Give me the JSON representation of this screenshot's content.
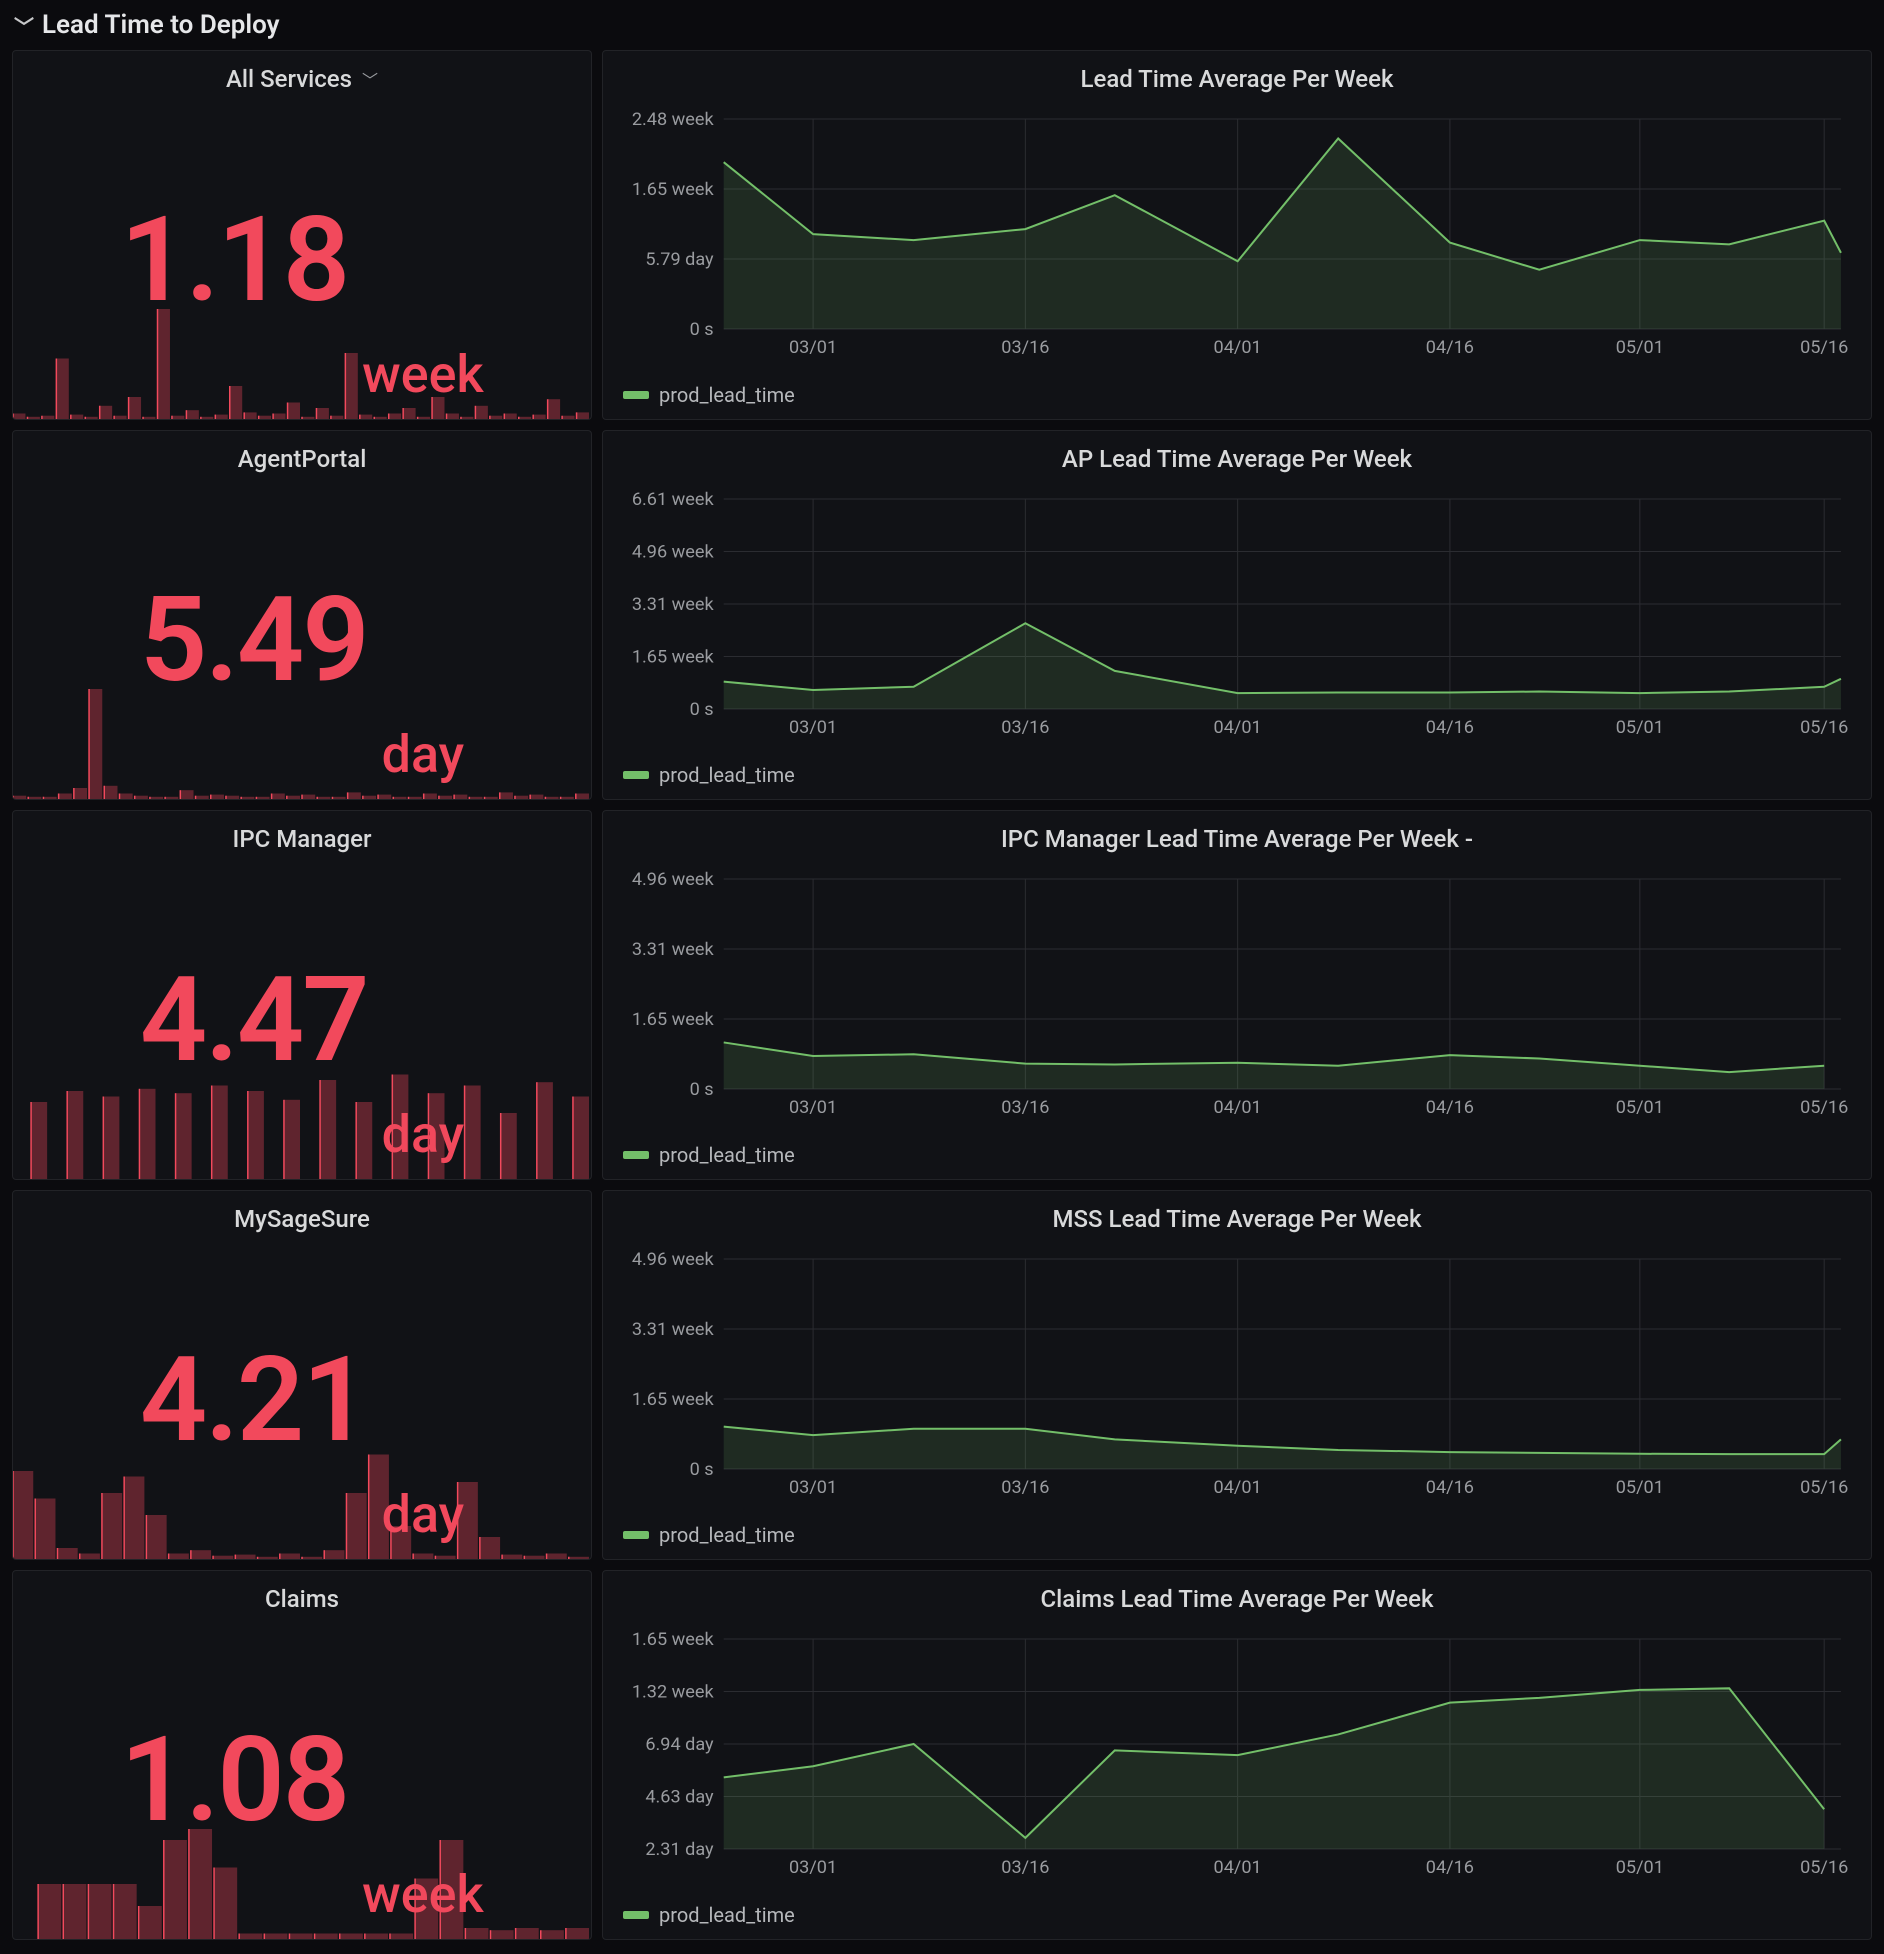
{
  "section_title": "Lead Time to Deploy",
  "rows": [
    {
      "stat": {
        "title": "All Services",
        "has_dropdown": true,
        "value": "1.18",
        "unit": "week"
      },
      "chart_title": "Lead Time Average Per Week",
      "legend": "prod_lead_time"
    },
    {
      "stat": {
        "title": "AgentPortal",
        "has_dropdown": false,
        "value": "5.49",
        "unit": "day"
      },
      "chart_title": "AP Lead Time Average Per Week",
      "legend": "prod_lead_time"
    },
    {
      "stat": {
        "title": "IPC Manager",
        "has_dropdown": false,
        "value": "4.47",
        "unit": "day"
      },
      "chart_title": "IPC Manager Lead Time Average Per Week -",
      "legend": "prod_lead_time"
    },
    {
      "stat": {
        "title": "MySageSure",
        "has_dropdown": false,
        "value": "4.21",
        "unit": "day"
      },
      "chart_title": "MSS Lead Time Average Per Week",
      "legend": "prod_lead_time"
    },
    {
      "stat": {
        "title": "Claims",
        "has_dropdown": false,
        "value": "1.08",
        "unit": "week"
      },
      "chart_title": "Claims Lead Time Average Per Week",
      "legend": "prod_lead_time"
    }
  ],
  "chart_data": [
    {
      "type": "line",
      "title": "Lead Time Average Per Week",
      "xlabel": "",
      "ylabel": "",
      "x_ticks": [
        "03/01",
        "03/16",
        "04/01",
        "04/16",
        "05/01",
        "05/16"
      ],
      "y_ticks": [
        "0 s",
        "5.79 day",
        "1.65 week",
        "2.48 week"
      ],
      "ylim_weeks": [
        0,
        2.48
      ],
      "series": [
        {
          "name": "prod_lead_time",
          "x": [
            "02/22",
            "03/01",
            "03/08",
            "03/16",
            "03/23",
            "04/01",
            "04/08",
            "04/16",
            "04/23",
            "05/01",
            "05/08",
            "05/16",
            "05/20"
          ],
          "y_weeks": [
            1.97,
            1.12,
            1.05,
            1.18,
            1.58,
            0.8,
            2.25,
            1.02,
            0.7,
            1.05,
            1.0,
            1.28,
            0.9
          ]
        }
      ]
    },
    {
      "type": "line",
      "title": "AP Lead Time Average Per Week",
      "xlabel": "",
      "ylabel": "",
      "x_ticks": [
        "03/01",
        "03/16",
        "04/01",
        "04/16",
        "05/01",
        "05/16"
      ],
      "y_ticks": [
        "0 s",
        "1.65 week",
        "3.31 week",
        "4.96 week",
        "6.61 week"
      ],
      "ylim_weeks": [
        0,
        6.61
      ],
      "series": [
        {
          "name": "prod_lead_time",
          "x": [
            "02/22",
            "03/01",
            "03/08",
            "03/16",
            "03/23",
            "04/01",
            "04/08",
            "04/16",
            "04/23",
            "05/01",
            "05/08",
            "05/16",
            "05/20"
          ],
          "y_weeks": [
            0.86,
            0.6,
            0.7,
            2.7,
            1.2,
            0.5,
            0.52,
            0.52,
            0.55,
            0.5,
            0.55,
            0.7,
            0.95
          ]
        }
      ]
    },
    {
      "type": "line",
      "title": "IPC Manager Lead Time Average Per Week -",
      "xlabel": "",
      "ylabel": "",
      "x_ticks": [
        "03/01",
        "03/16",
        "04/01",
        "04/16",
        "05/01",
        "05/16"
      ],
      "y_ticks": [
        "0 s",
        "1.65 week",
        "3.31 week",
        "4.96 week"
      ],
      "ylim_weeks": [
        0,
        4.96
      ],
      "series": [
        {
          "name": "prod_lead_time",
          "x": [
            "02/22",
            "03/01",
            "03/08",
            "03/16",
            "03/23",
            "04/01",
            "04/08",
            "04/16",
            "04/23",
            "05/01",
            "05/08",
            "05/16"
          ],
          "y_weeks": [
            1.1,
            0.78,
            0.82,
            0.6,
            0.58,
            0.62,
            0.55,
            0.8,
            0.72,
            0.55,
            0.4,
            0.55
          ]
        }
      ]
    },
    {
      "type": "line",
      "title": "MSS Lead Time Average Per Week",
      "xlabel": "",
      "ylabel": "",
      "x_ticks": [
        "03/01",
        "03/16",
        "04/01",
        "04/16",
        "05/01",
        "05/16"
      ],
      "y_ticks": [
        "0 s",
        "1.65 week",
        "3.31 week",
        "4.96 week"
      ],
      "ylim_weeks": [
        0,
        4.96
      ],
      "series": [
        {
          "name": "prod_lead_time",
          "x": [
            "02/22",
            "03/01",
            "03/08",
            "03/16",
            "03/23",
            "04/01",
            "04/08",
            "04/16",
            "04/23",
            "05/01",
            "05/08",
            "05/16",
            "05/20"
          ],
          "y_weeks": [
            1.0,
            0.8,
            0.95,
            0.95,
            0.7,
            0.55,
            0.45,
            0.4,
            0.38,
            0.36,
            0.35,
            0.35,
            0.7
          ]
        }
      ]
    },
    {
      "type": "line",
      "title": "Claims Lead Time Average Per Week",
      "xlabel": "",
      "ylabel": "",
      "x_ticks": [
        "03/01",
        "03/16",
        "04/01",
        "04/16",
        "05/01",
        "05/16"
      ],
      "y_ticks": [
        "2.31 day",
        "4.63 day",
        "6.94 day",
        "1.32 week",
        "1.65 week"
      ],
      "ylim_weeks": [
        0.33,
        1.65
      ],
      "series": [
        {
          "name": "prod_lead_time",
          "x": [
            "02/22",
            "03/01",
            "03/08",
            "03/16",
            "03/23",
            "04/01",
            "04/08",
            "04/16",
            "04/23",
            "05/01",
            "05/08",
            "05/16"
          ],
          "y_weeks": [
            0.78,
            0.85,
            0.99,
            0.4,
            0.95,
            0.92,
            1.05,
            1.25,
            1.28,
            1.33,
            1.34,
            0.58
          ]
        }
      ]
    }
  ],
  "sparklines": [
    {
      "values": [
        0.05,
        0.02,
        0.03,
        0.55,
        0.04,
        0.02,
        0.12,
        0.03,
        0.2,
        0.02,
        1.0,
        0.03,
        0.08,
        0.02,
        0.04,
        0.3,
        0.06,
        0.03,
        0.05,
        0.15,
        0.02,
        0.1,
        0.03,
        0.6,
        0.04,
        0.02,
        0.05,
        0.1,
        0.02,
        0.2,
        0.05,
        0.02,
        0.12,
        0.03,
        0.05,
        0.02,
        0.04,
        0.18,
        0.03,
        0.06
      ]
    },
    {
      "values": [
        0.03,
        0.02,
        0.02,
        0.05,
        0.1,
        1.0,
        0.12,
        0.05,
        0.03,
        0.02,
        0.02,
        0.08,
        0.03,
        0.04,
        0.03,
        0.02,
        0.02,
        0.05,
        0.03,
        0.04,
        0.02,
        0.02,
        0.06,
        0.03,
        0.04,
        0.02,
        0.02,
        0.05,
        0.03,
        0.04,
        0.02,
        0.02,
        0.06,
        0.03,
        0.04,
        0.02,
        0.02,
        0.05
      ]
    },
    {
      "values": [
        0.0,
        0.7,
        0.0,
        0.8,
        0.0,
        0.75,
        0.0,
        0.82,
        0.0,
        0.78,
        0.0,
        0.85,
        0.0,
        0.8,
        0.0,
        0.72,
        0.0,
        0.9,
        0.0,
        0.7,
        0.0,
        0.95,
        0.0,
        0.78,
        0.0,
        0.85,
        0.0,
        0.6,
        0.0,
        0.88,
        0.0,
        0.75
      ]
    },
    {
      "values": [
        0.8,
        0.55,
        0.1,
        0.05,
        0.6,
        0.75,
        0.4,
        0.05,
        0.08,
        0.03,
        0.04,
        0.02,
        0.05,
        0.02,
        0.08,
        0.6,
        0.95,
        0.3,
        0.05,
        0.03,
        0.7,
        0.2,
        0.04,
        0.03,
        0.05,
        0.02
      ]
    },
    {
      "values": [
        0.0,
        0.5,
        0.5,
        0.5,
        0.5,
        0.3,
        0.9,
        1.0,
        0.65,
        0.05,
        0.05,
        0.05,
        0.05,
        0.05,
        0.05,
        0.05,
        0.55,
        0.9,
        0.1,
        0.08,
        0.1,
        0.08,
        0.1
      ]
    }
  ]
}
